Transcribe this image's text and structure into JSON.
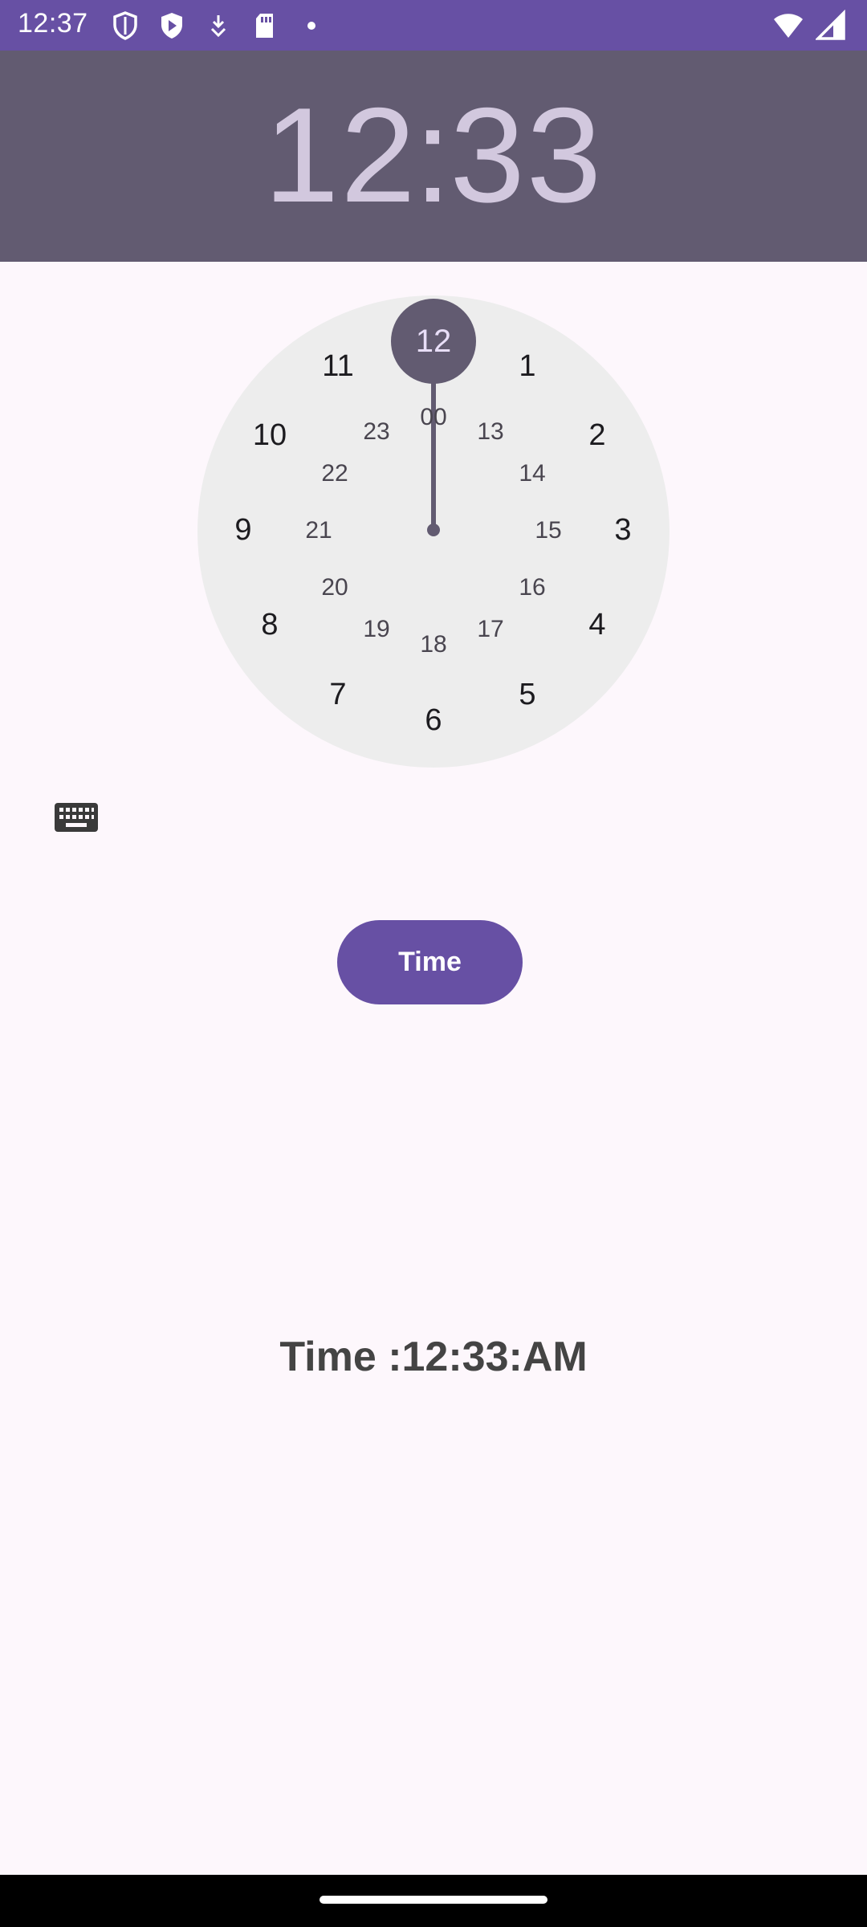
{
  "status_bar": {
    "time": "12:37",
    "left_icons": [
      "shield-icon",
      "play-protect-icon",
      "download-icon",
      "sd-card-icon",
      "dot-icon"
    ],
    "right_icons": [
      "wifi-icon",
      "signal-icon"
    ],
    "color": "#6750a4"
  },
  "header": {
    "hour": "12",
    "separator": ":",
    "minute": "33",
    "background": "#625b71"
  },
  "clock": {
    "selected": "12",
    "outer_numbers": [
      "11",
      "1",
      "10",
      "2",
      "9",
      "3",
      "8",
      "4",
      "7",
      "5",
      "6"
    ],
    "inner_numbers": [
      "00",
      "23",
      "13",
      "22",
      "14",
      "21",
      "15",
      "20",
      "16",
      "19",
      "17",
      "18"
    ]
  },
  "keyboard_toggle": {
    "icon": "keyboard-icon"
  },
  "time_button": {
    "label": "Time",
    "color": "#6750a4"
  },
  "result": {
    "text": "Time :12:33:AM"
  }
}
